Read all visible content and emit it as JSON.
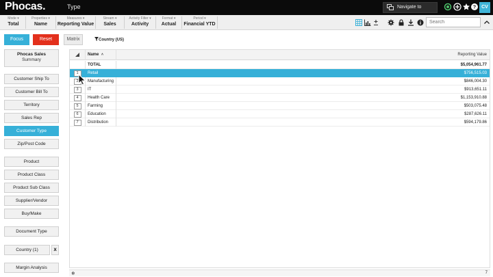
{
  "app": {
    "logo": "Phocas.",
    "page_title": "Type"
  },
  "header": {
    "navigate_label": "Navigate to",
    "avatar_initials": "CV",
    "icons": [
      "navigate-icon",
      "status-icon",
      "add-circle-icon",
      "star-icon",
      "help-icon"
    ]
  },
  "toolbar": {
    "items": [
      {
        "label": "Mode ▾",
        "value": "Total"
      },
      {
        "label": "Properties ▾",
        "value": "Name"
      },
      {
        "label": "Measures ▾",
        "value": "Reporting Value"
      },
      {
        "label": "Stream ▾",
        "value": "Sales"
      },
      {
        "label": "Activity Filter ▾",
        "value": "Activity"
      },
      {
        "label": "Format ▾",
        "value": "Actual"
      },
      {
        "label": "Period ▾",
        "value": "Financial YTD"
      }
    ],
    "search_placeholder": "Search",
    "icons": [
      "grid-view-icon",
      "chart-icon",
      "plus-minus-icon",
      "settings-icon",
      "lock-icon",
      "download-icon",
      "info-icon",
      "collapse-icon"
    ]
  },
  "actions": {
    "focus": "Focus",
    "reset": "Reset",
    "matrix": "Matrix",
    "filter": "Country (US)"
  },
  "sidebar": {
    "summary_title": "Phocas Sales",
    "summary_subtitle": "Summary",
    "items": [
      "Customer Ship To",
      "Customer Bill To",
      "Territory",
      "Sales Rep",
      "Customer Type",
      "Zip/Post Code",
      "Product",
      "Product Class",
      "Product Sub Class",
      "Supplier/Vendor",
      "Buy/Make",
      "Document Type",
      "Country (1)",
      "Margin Analysis"
    ],
    "active": "Customer Type",
    "remove_label": "X"
  },
  "grid": {
    "columns": {
      "name": "Name",
      "sort_icon": "˄",
      "value": "Reporting Value"
    },
    "total": {
      "label": "TOTAL",
      "value": "$5,054,961.77"
    },
    "rows": [
      {
        "idx": "1",
        "name": "Retail",
        "value": "$756,515.03",
        "selected": true
      },
      {
        "idx": "2",
        "name": "Manufacturing",
        "value": "$846,004.30"
      },
      {
        "idx": "3",
        "name": "IT",
        "value": "$913,651.11"
      },
      {
        "idx": "4",
        "name": "Health Care",
        "value": "$1,153,910.88"
      },
      {
        "idx": "5",
        "name": "Farming",
        "value": "$503,075.48"
      },
      {
        "idx": "6",
        "name": "Education",
        "value": "$287,626.11"
      },
      {
        "idx": "7",
        "name": "Distribution",
        "value": "$594,179.86"
      }
    ],
    "footer_count": "7"
  },
  "colors": {
    "accent": "#36b0d8",
    "reset": "#e3301c",
    "topbar": "#0b0b0b"
  }
}
